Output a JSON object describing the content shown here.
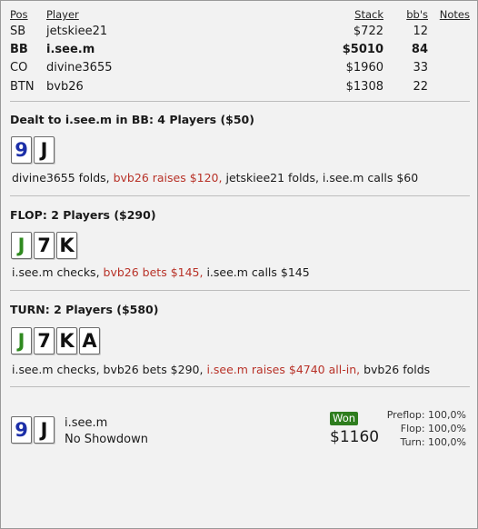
{
  "players_header": {
    "pos": "Pos",
    "player": "Player",
    "stack": "Stack",
    "bbs": "bb's",
    "notes": "Notes"
  },
  "players": [
    {
      "pos": "SB",
      "name": "jetskiee21",
      "stack": "$722",
      "bbs": "12",
      "hero": false
    },
    {
      "pos": "BB",
      "name": "i.see.m",
      "stack": "$5010",
      "bbs": "84",
      "hero": true
    },
    {
      "pos": "CO",
      "name": "divine3655",
      "stack": "$1960",
      "bbs": "33",
      "hero": false
    },
    {
      "pos": "BTN",
      "name": "bvb26",
      "stack": "$1308",
      "bbs": "22",
      "hero": false
    }
  ],
  "preflop": {
    "title": "Dealt to i.see.m in BB: 4 Players ($50)",
    "cards": [
      {
        "rank": "9",
        "color": "#1c2fa8"
      },
      {
        "rank": "J",
        "color": "#111111"
      }
    ],
    "actions": [
      {
        "text": "divine3655 folds, ",
        "highlight": false
      },
      {
        "text": "bvb26 raises $120, ",
        "highlight": true
      },
      {
        "text": "jetskiee21 folds, i.see.m calls $60",
        "highlight": false
      }
    ]
  },
  "flop": {
    "title": "FLOP: 2 Players ($290)",
    "cards": [
      {
        "rank": "J",
        "color": "#2f8a1f"
      },
      {
        "rank": "7",
        "color": "#111111"
      },
      {
        "rank": "K",
        "color": "#111111"
      }
    ],
    "actions": [
      {
        "text": "i.see.m checks, ",
        "highlight": false
      },
      {
        "text": "bvb26 bets $145, ",
        "highlight": true
      },
      {
        "text": "i.see.m calls $145",
        "highlight": false
      }
    ]
  },
  "turn": {
    "title": "TURN: 2 Players ($580)",
    "cards": [
      {
        "rank": "J",
        "color": "#2f8a1f"
      },
      {
        "rank": "7",
        "color": "#111111"
      },
      {
        "rank": "K",
        "color": "#111111"
      },
      {
        "rank": "A",
        "color": "#111111"
      }
    ],
    "actions": [
      {
        "text": "i.see.m checks, bvb26 bets $290, ",
        "highlight": false
      },
      {
        "text": "i.see.m raises $4740 all-in, ",
        "highlight": true
      },
      {
        "text": "bvb26 folds",
        "highlight": false
      }
    ]
  },
  "summary": {
    "cards": [
      {
        "rank": "9",
        "color": "#1c2fa8"
      },
      {
        "rank": "J",
        "color": "#111111"
      }
    ],
    "player": "i.see.m",
    "result": "No Showdown",
    "won_label": "Won",
    "won_amount": "$1160",
    "equity": [
      "Preflop: 100,0%",
      "Flop: 100,0%",
      "Turn: 100,0%"
    ]
  },
  "colors": {
    "highlight": "#b83228",
    "won_badge": "#2e7d1e"
  }
}
